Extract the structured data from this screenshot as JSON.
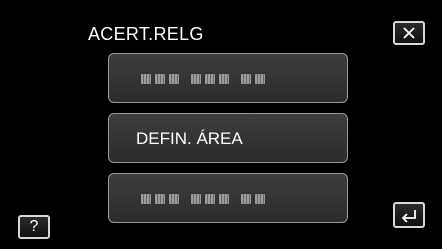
{
  "screen": {
    "title": "ACERT.RELG"
  },
  "buttons": {
    "close_icon": "close-icon",
    "help_label": "?",
    "back_icon": "return-arrow-icon"
  },
  "options": [
    {
      "label": "",
      "placeholder_icon": "obscured-text-icon"
    },
    {
      "label": "DEFIN. ÁREA"
    },
    {
      "label": "",
      "placeholder_icon": "obscured-text-icon"
    }
  ],
  "colors": {
    "background": "#000000",
    "button_border": "#d8d8d8",
    "option_fill": "#333333",
    "option_border": "#9a9a9a"
  }
}
